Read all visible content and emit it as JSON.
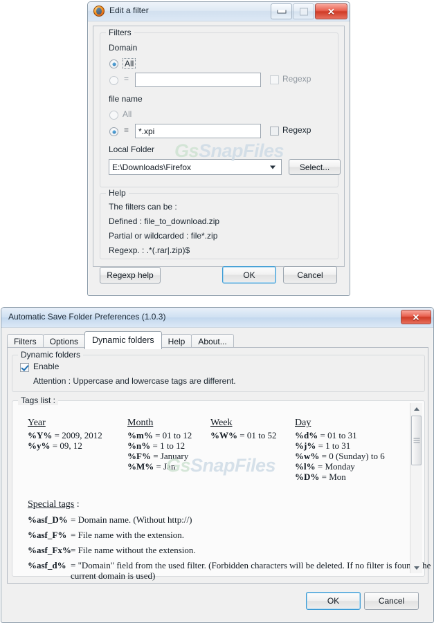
{
  "watermark": {
    "prefix": "Gs",
    "text": "SnapFiles"
  },
  "edit_filter_window": {
    "title": "Edit a filter",
    "icon": "firefox-icon",
    "window_buttons": {
      "minimize": "minimize-icon",
      "maximize": "maximize-icon",
      "close": "close-icon",
      "close_glyph": "✕"
    },
    "filters_group": {
      "label": "Filters",
      "domain": {
        "label": "Domain",
        "all_label": "All",
        "equals_label": "=",
        "value": "",
        "regexp_label": "Regexp",
        "regexp_checked": false,
        "selected": "all"
      },
      "file_name": {
        "label": "file name",
        "all_label": "All",
        "equals_label": "=",
        "value": "*.xpi",
        "regexp_label": "Regexp",
        "regexp_checked": false,
        "selected": "equals"
      },
      "local_folder": {
        "label": "Local Folder",
        "value": "E:\\Downloads\\Firefox",
        "select_button": "Select..."
      }
    },
    "help_group": {
      "label": "Help",
      "lines": [
        "The filters can be :",
        "Defined : file_to_download.zip",
        "Partial or wildcarded : file*.zip",
        "Regexp. : .*(.rar|.zip)$"
      ]
    },
    "buttons": {
      "regexp_help": "Regexp help",
      "ok": "OK",
      "cancel": "Cancel"
    }
  },
  "preferences_window": {
    "title": "Automatic Save Folder Preferences (1.0.3)",
    "close_glyph": "✕",
    "tabs": [
      {
        "label": "Filters",
        "active": false
      },
      {
        "label": "Options",
        "active": false
      },
      {
        "label": "Dynamic folders",
        "active": true
      },
      {
        "label": "Help",
        "active": false
      },
      {
        "label": "About...",
        "active": false
      }
    ],
    "dynamic_folders": {
      "group_label": "Dynamic folders",
      "enable_label": "Enable",
      "enable_checked": true,
      "attention": "Attention : Uppercase and lowercase tags are different.",
      "tags_list_label": "Tags list :",
      "columns": [
        {
          "heading": "Year",
          "rows": [
            {
              "tag": "%Y%",
              "desc": "= 2009, 2012"
            },
            {
              "tag": "%y%",
              "desc": "= 09, 12"
            }
          ]
        },
        {
          "heading": "Month",
          "rows": [
            {
              "tag": "%m%",
              "desc": "= 01 to 12"
            },
            {
              "tag": "%n%",
              "desc": "= 1 to 12"
            },
            {
              "tag": "%F%",
              "desc": "= January"
            },
            {
              "tag": "%M%",
              "desc": "= Jan"
            }
          ]
        },
        {
          "heading": "Week",
          "rows": [
            {
              "tag": "%W%",
              "desc": "= 01 to 52"
            }
          ]
        },
        {
          "heading": "Day",
          "rows": [
            {
              "tag": "%d%",
              "desc": "= 01 to 31"
            },
            {
              "tag": "%j%",
              "desc": "= 1 to 31"
            },
            {
              "tag": "%w%",
              "desc": "= 0 (Sunday) to 6"
            },
            {
              "tag": "%l%",
              "desc": "= Monday"
            },
            {
              "tag": "%D%",
              "desc": "= Mon"
            }
          ]
        }
      ],
      "special_tags_label": "Special tags",
      "special_tags_suffix": " :",
      "special_tags": [
        {
          "tag": "%asf_D%",
          "desc": "= Domain name. (Without http://)"
        },
        {
          "tag": "%asf_F%",
          "desc": "= File name with the extension."
        },
        {
          "tag": "%asf_Fx%",
          "desc": "= File name without the extension."
        },
        {
          "tag": "%asf_d%",
          "desc": "= \"Domain\" field from the used filter. (Forbidden characters will be deleted. If no filter is found, the"
        }
      ],
      "special_tags_continuation": "current domain is used)"
    },
    "buttons": {
      "ok": "OK",
      "cancel": "Cancel"
    }
  }
}
